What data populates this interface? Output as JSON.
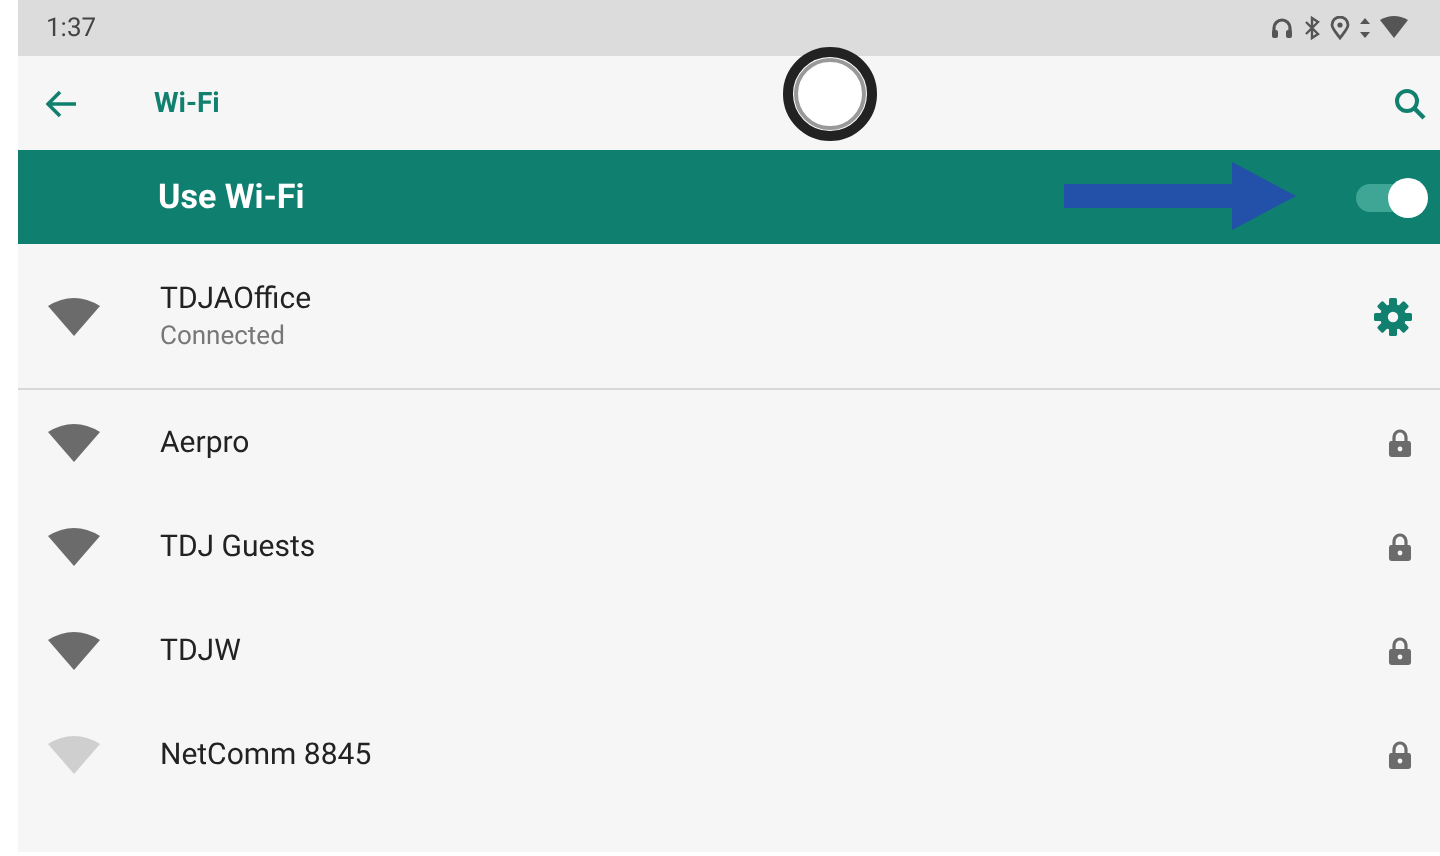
{
  "status_bar": {
    "time": "1:37"
  },
  "toolbar": {
    "title": "Wi-Fi"
  },
  "master_switch": {
    "label": "Use Wi-Fi",
    "on": true
  },
  "networks": [
    {
      "kind": "connected",
      "name": "TDJAOffice",
      "subtitle": "Connected",
      "weak_signal": false
    },
    {
      "kind": "secured",
      "name": "Aerpro",
      "weak_signal": false
    },
    {
      "kind": "secured",
      "name": "TDJ Guests",
      "weak_signal": false
    },
    {
      "kind": "secured",
      "name": "TDJW",
      "weak_signal": false
    },
    {
      "kind": "secured",
      "name": "NetComm 8845",
      "weak_signal": true
    }
  ]
}
